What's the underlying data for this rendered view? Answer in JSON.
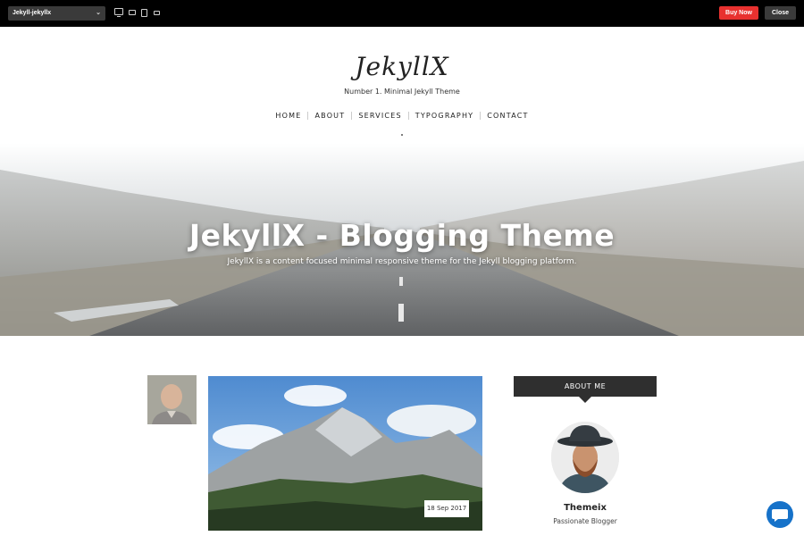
{
  "topbar": {
    "theme_select": "Jekyll-jekyllx",
    "devices": [
      "desktop-icon",
      "laptop-icon",
      "tablet-icon",
      "phone-icon"
    ],
    "buy_label": "Buy Now",
    "close_label": "Close",
    "colors": {
      "bar": "#000000",
      "buy": "#e8312f",
      "close": "#3a3a3a"
    }
  },
  "site": {
    "logo": "JekyllX",
    "tagline": "Number 1. Minimal Jekyll Theme",
    "nav": [
      "HOME",
      "ABOUT",
      "SERVICES",
      "TYPOGRAPHY",
      "CONTACT"
    ]
  },
  "hero": {
    "title": "JekyllX - Blogging Theme",
    "subtitle": "JekyllX is a content focused minimal responsive theme for the Jekyll blogging platform."
  },
  "post": {
    "date": "18 Sep 2017"
  },
  "sidebar": {
    "about_title": "ABOUT ME",
    "name": "Themeix",
    "role": "Passionate Blogger"
  },
  "chat": {
    "icon": "chat-bubble-icon",
    "color": "#1672c9"
  }
}
